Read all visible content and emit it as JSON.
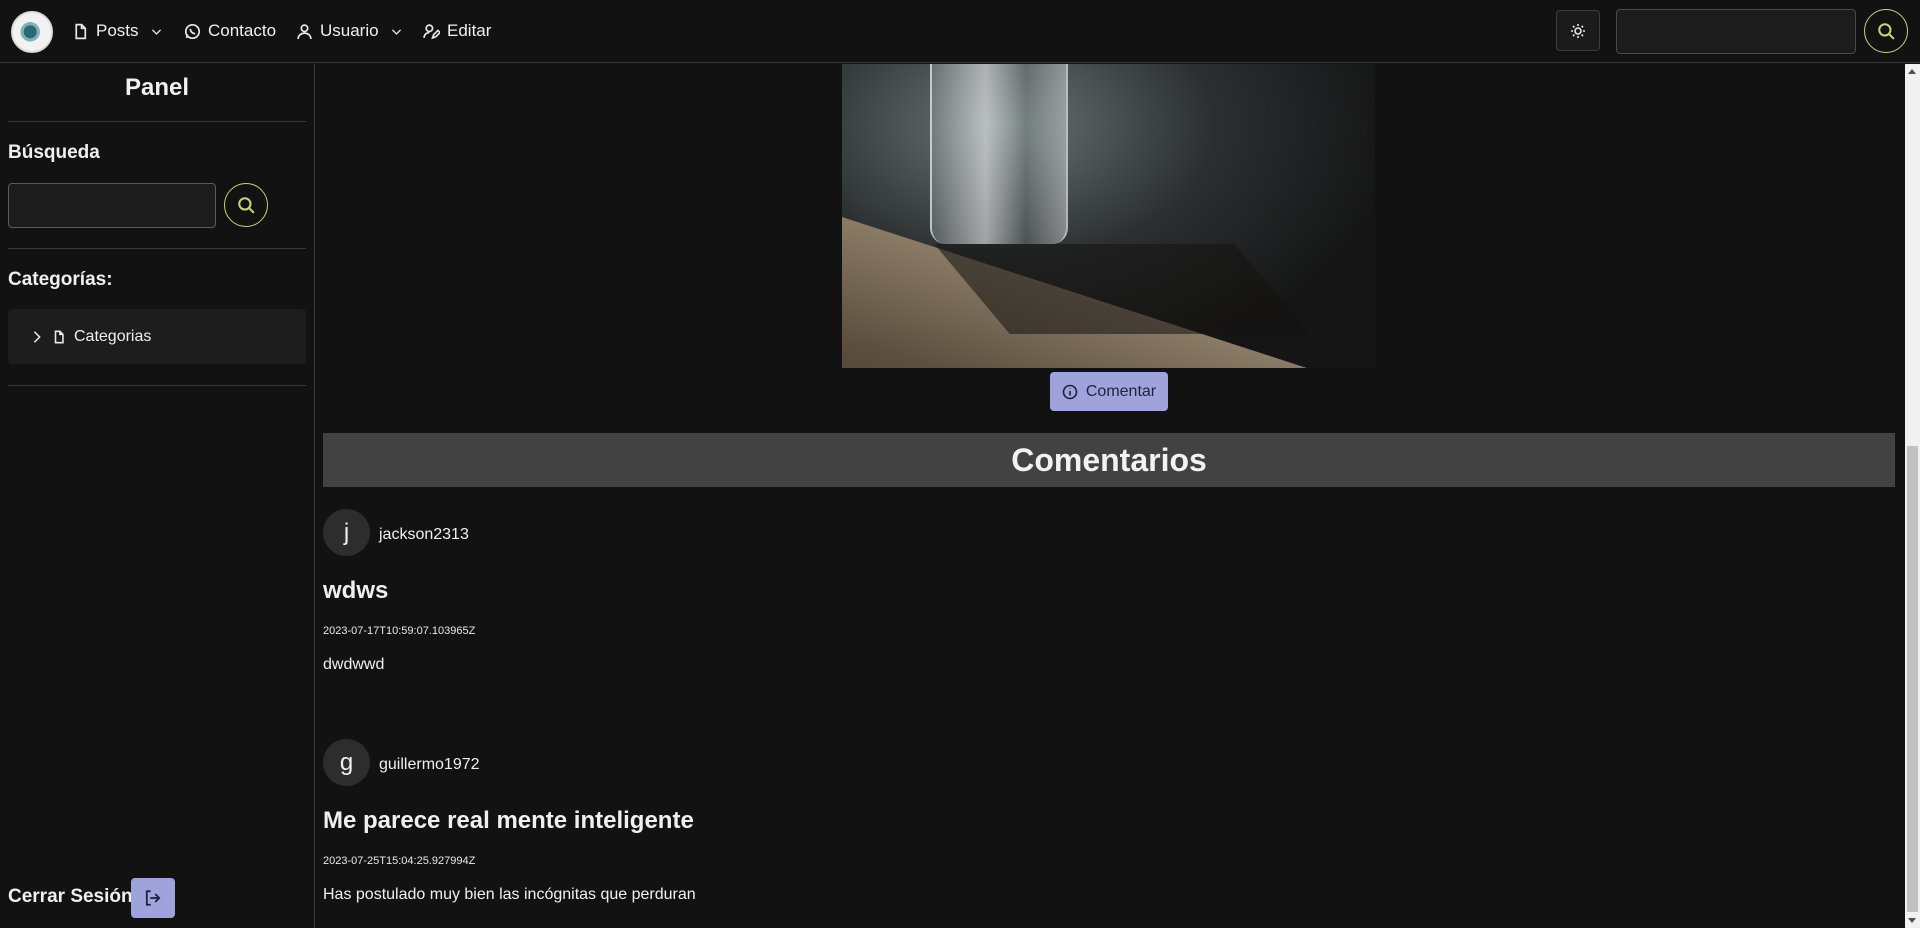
{
  "nav": {
    "posts": "Posts",
    "contacto": "Contacto",
    "usuario": "Usuario",
    "editar": "Editar",
    "search_value": ""
  },
  "sidebar": {
    "title": "Panel",
    "search_heading": "Búsqueda",
    "search_value": "",
    "categories_heading": "Categorías:",
    "category_item": "Categorias",
    "logout_label": "Cerrar Sesión"
  },
  "post": {
    "comment_button": "Comentar"
  },
  "comments": {
    "heading": "Comentarios",
    "items": [
      {
        "initial": "j",
        "user": "jackson2313",
        "title": "wdws",
        "date": "2023-07-17T10:59:07.103965Z",
        "body": "dwdwwd"
      },
      {
        "initial": "g",
        "user": "guillermo1972",
        "title": "Me parece real mente inteligente",
        "date": "2023-07-25T15:04:25.927994Z",
        "body": "Has postulado muy bien las incógnitas que perduran"
      }
    ]
  },
  "colors": {
    "accent": "#9fa3dc",
    "search_ring": "#c8d27a",
    "background": "#121212",
    "comments_header": "#424242"
  }
}
